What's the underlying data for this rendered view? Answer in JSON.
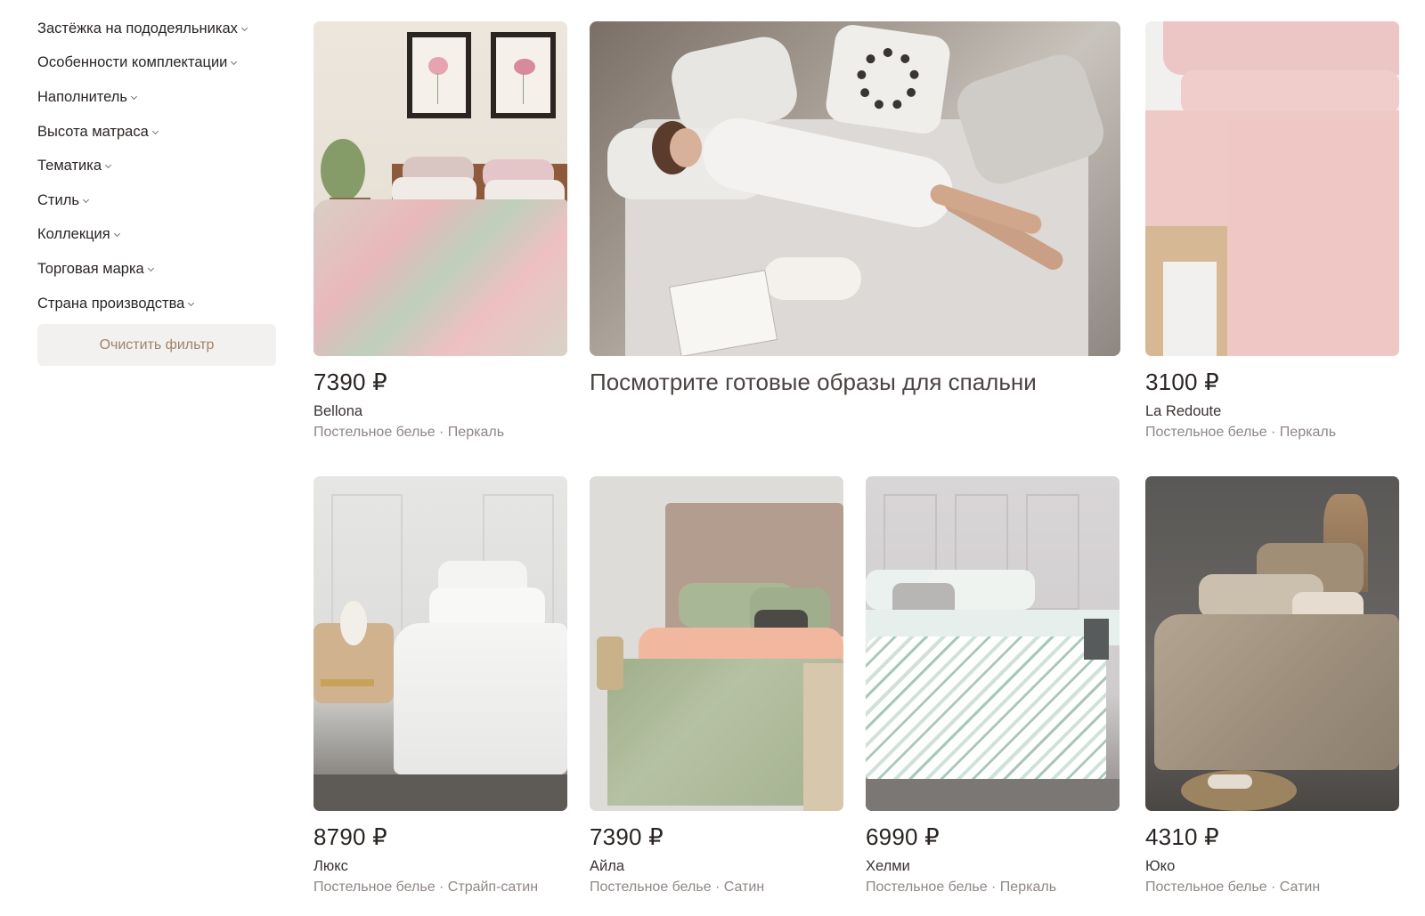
{
  "filters": {
    "items": [
      "Застёжка на пододеяльниках",
      "Особенности комплектации",
      "Наполнитель",
      "Высота матраса",
      "Тематика",
      "Стиль",
      "Коллекция",
      "Торговая марка",
      "Страна производства"
    ],
    "clear_label": "Очистить фильтр"
  },
  "promo": {
    "text": "Посмотрите готовые образы для спальни"
  },
  "products": [
    {
      "price": "7390 ₽",
      "name": "Bellona",
      "desc": "Постельное белье · Перкаль"
    },
    {
      "price": "3100 ₽",
      "name": "La Redoute",
      "desc": "Постельное белье · Перкаль"
    },
    {
      "price": "8790 ₽",
      "name": "Люкс",
      "desc": "Постельное белье · Страйп-сатин"
    },
    {
      "price": "7390 ₽",
      "name": "Айла",
      "desc": "Постельное белье · Сатин"
    },
    {
      "price": "6990 ₽",
      "name": "Хелми",
      "desc": "Постельное белье · Перкаль"
    },
    {
      "price": "4310 ₽",
      "name": "Юко",
      "desc": "Постельное белье · Сатин"
    }
  ],
  "colors": {
    "text_main": "#2a2523",
    "text_muted": "#8e8784",
    "clear_button_bg": "#f3f1ef",
    "clear_button_text": "#a0836a"
  }
}
